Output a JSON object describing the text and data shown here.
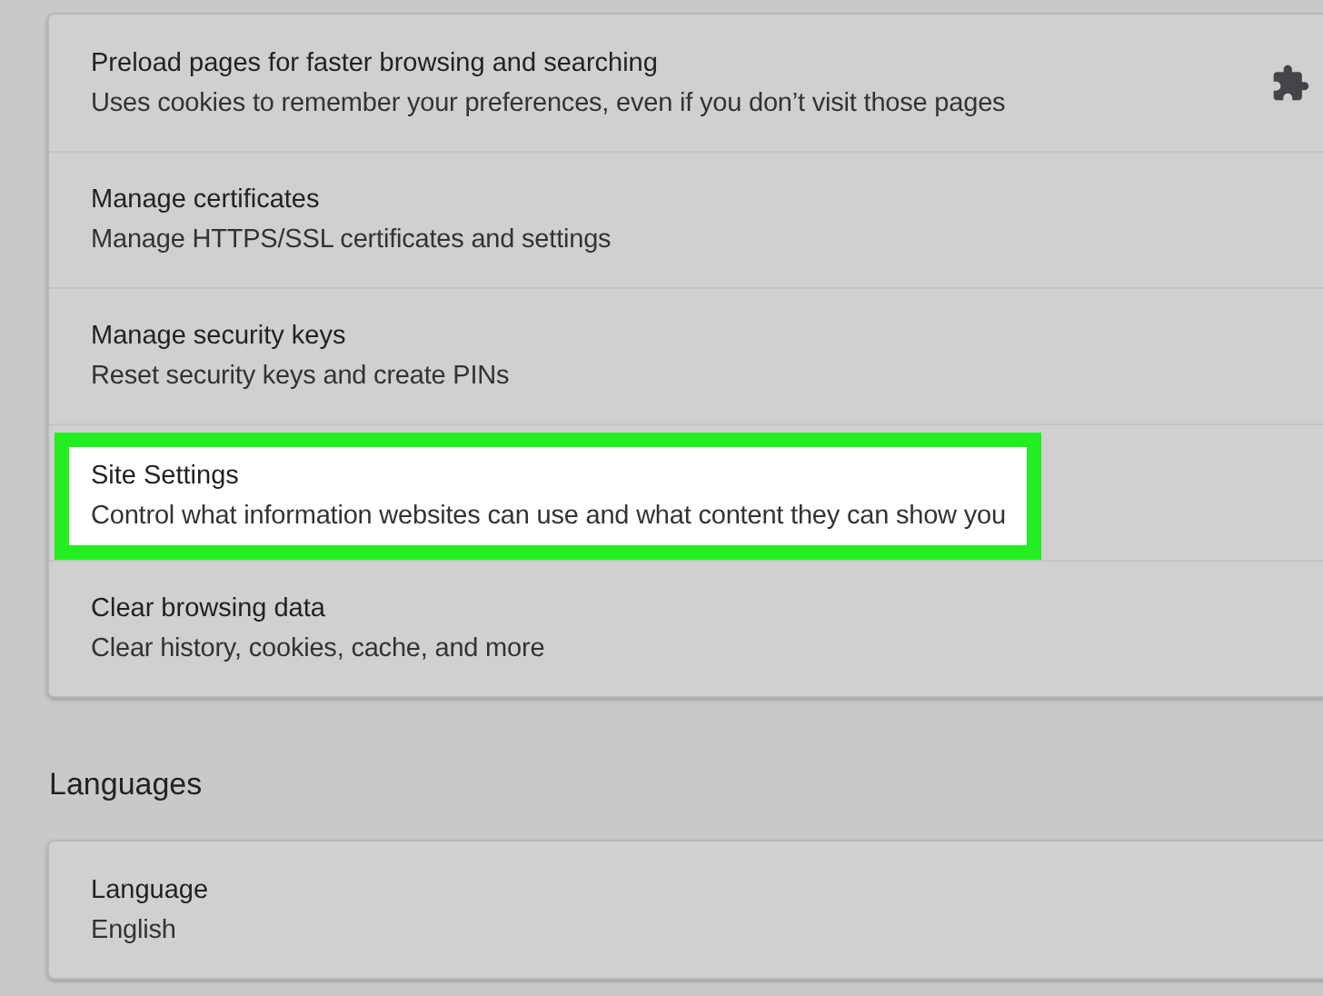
{
  "sections": [
    {
      "items": [
        {
          "title": "Preload pages for faster browsing and searching",
          "subtitle": "Uses cookies to remember your preferences, even if you don’t visit those pages",
          "kind": "extension",
          "highlighted": false
        },
        {
          "title": "Manage certificates",
          "subtitle": "Manage HTTPS/SSL certificates and settings",
          "kind": "plain",
          "highlighted": false
        },
        {
          "title": "Manage security keys",
          "subtitle": "Reset security keys and create PINs",
          "kind": "plain",
          "highlighted": false
        },
        {
          "title": "Site Settings",
          "subtitle": "Control what information websites can use and what content they can show you",
          "kind": "plain",
          "highlighted": true
        },
        {
          "title": "Clear browsing data",
          "subtitle": "Clear history, cookies, cache, and more",
          "kind": "plain",
          "highlighted": false
        }
      ]
    },
    {
      "heading": "Languages",
      "items": [
        {
          "title": "Language",
          "subtitle": "English",
          "kind": "plain",
          "highlighted": false
        }
      ]
    }
  ]
}
